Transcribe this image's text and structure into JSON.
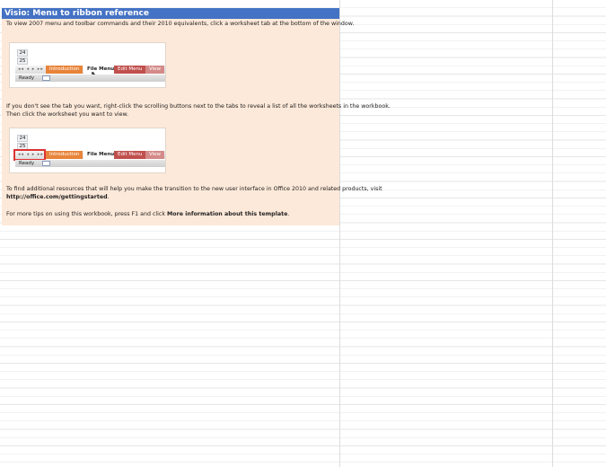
{
  "sheet": {
    "title": "Visio: Menu to ribbon reference",
    "intro_line": "To view 2007 menu and toolbar commands and their 2010 equivalents, click a worksheet tab at the bottom of the window.",
    "scroll_line_1": "If you don't see the tab you want, right-click the scrolling buttons next to the tabs to reveal a list of all the worksheets in the workbook.",
    "scroll_line_2": "Then click the worksheet you want to view.",
    "resources_line": "To find additional resources that will help you make the transition to the new user interface in Office 2010 and related products, visit",
    "resources_url": "http://office.com/gettingstarted",
    "resources_end": ".",
    "tips_prefix": "For more tips on using this workbook, press F1 and click ",
    "tips_link": "More information about this template",
    "tips_end": "."
  },
  "thumbnail": {
    "row_a": "24",
    "row_b": "25",
    "nav_buttons": "◂◂ ◂ ▸ ▸▸",
    "tab_intro": "Introduction",
    "tab_file": "File Menu",
    "tab_edit": "Edit Menu",
    "tab_more": "View",
    "status": "Ready"
  },
  "colors": {
    "title_bg": "#4472c4",
    "content_bg": "#fde9d9",
    "tab_intro": "#e8843a",
    "tab_edit": "#c0504d",
    "highlight": "#dd3333"
  },
  "icons": [
    "mouse-cursor-icon",
    "macro-record-icon"
  ]
}
